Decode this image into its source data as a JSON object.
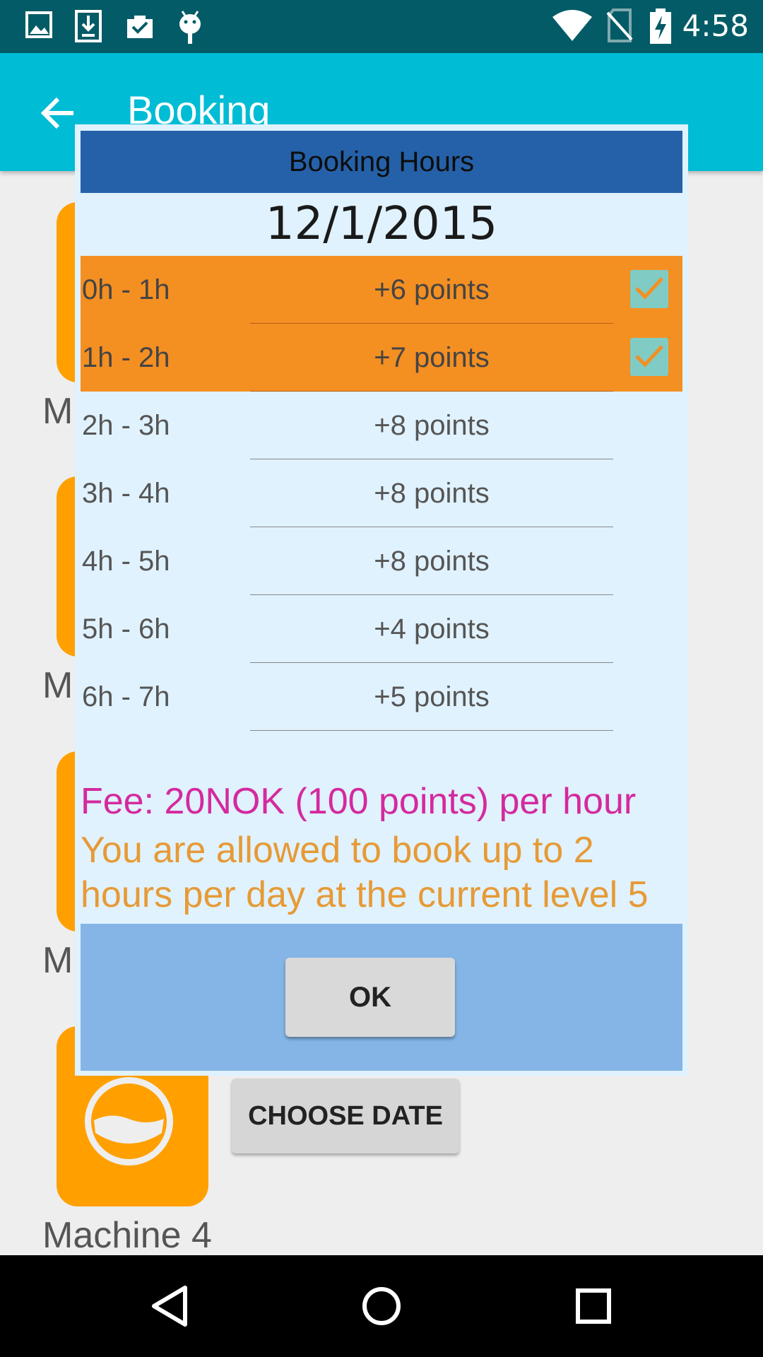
{
  "status_bar": {
    "time": "4:58",
    "left_icons": [
      "image-icon",
      "download-icon",
      "briefcase-check-icon",
      "android-icon"
    ],
    "right_icons": [
      "wifi-icon",
      "no-sim-icon",
      "battery-charging-icon"
    ]
  },
  "app_bar": {
    "title": "Booking",
    "back_icon": "arrow-back-icon"
  },
  "background": {
    "machines": [
      {
        "label": "M"
      },
      {
        "label": "M"
      },
      {
        "label": "M"
      },
      {
        "label": "Machine 4"
      }
    ],
    "choose_date_label": "CHOOSE DATE"
  },
  "dialog": {
    "title": "Booking Hours",
    "date": "12/1/2015",
    "hours": [
      {
        "time": "0h - 1h",
        "points": "+6 points",
        "checked": true
      },
      {
        "time": "1h - 2h",
        "points": "+7 points",
        "checked": true
      },
      {
        "time": "2h - 3h",
        "points": "+8 points",
        "checked": false
      },
      {
        "time": "3h - 4h",
        "points": "+8 points",
        "checked": false
      },
      {
        "time": "4h - 5h",
        "points": "+8 points",
        "checked": false
      },
      {
        "time": "5h - 6h",
        "points": "+4 points",
        "checked": false
      },
      {
        "time": "6h - 7h",
        "points": "+5 points",
        "checked": false
      }
    ],
    "fee_text": "Fee: 20NOK (100 points) per hour",
    "allowance_text": "You are allowed to book up to 2 hours per day at the current level 5",
    "ok_label": "OK"
  },
  "colors": {
    "status_bar": "#025b66",
    "app_bar": "#00bcd4",
    "dialog_header": "#2561a8",
    "selected_row": "#f48f22",
    "fee_text": "#d42a9e",
    "allowance_text": "#e69a36",
    "dialog_footer": "#84b5e6",
    "machine_card": "#ffa000"
  },
  "nav_bar": {
    "icons": [
      "back-triangle-icon",
      "home-circle-icon",
      "recents-square-icon"
    ]
  }
}
